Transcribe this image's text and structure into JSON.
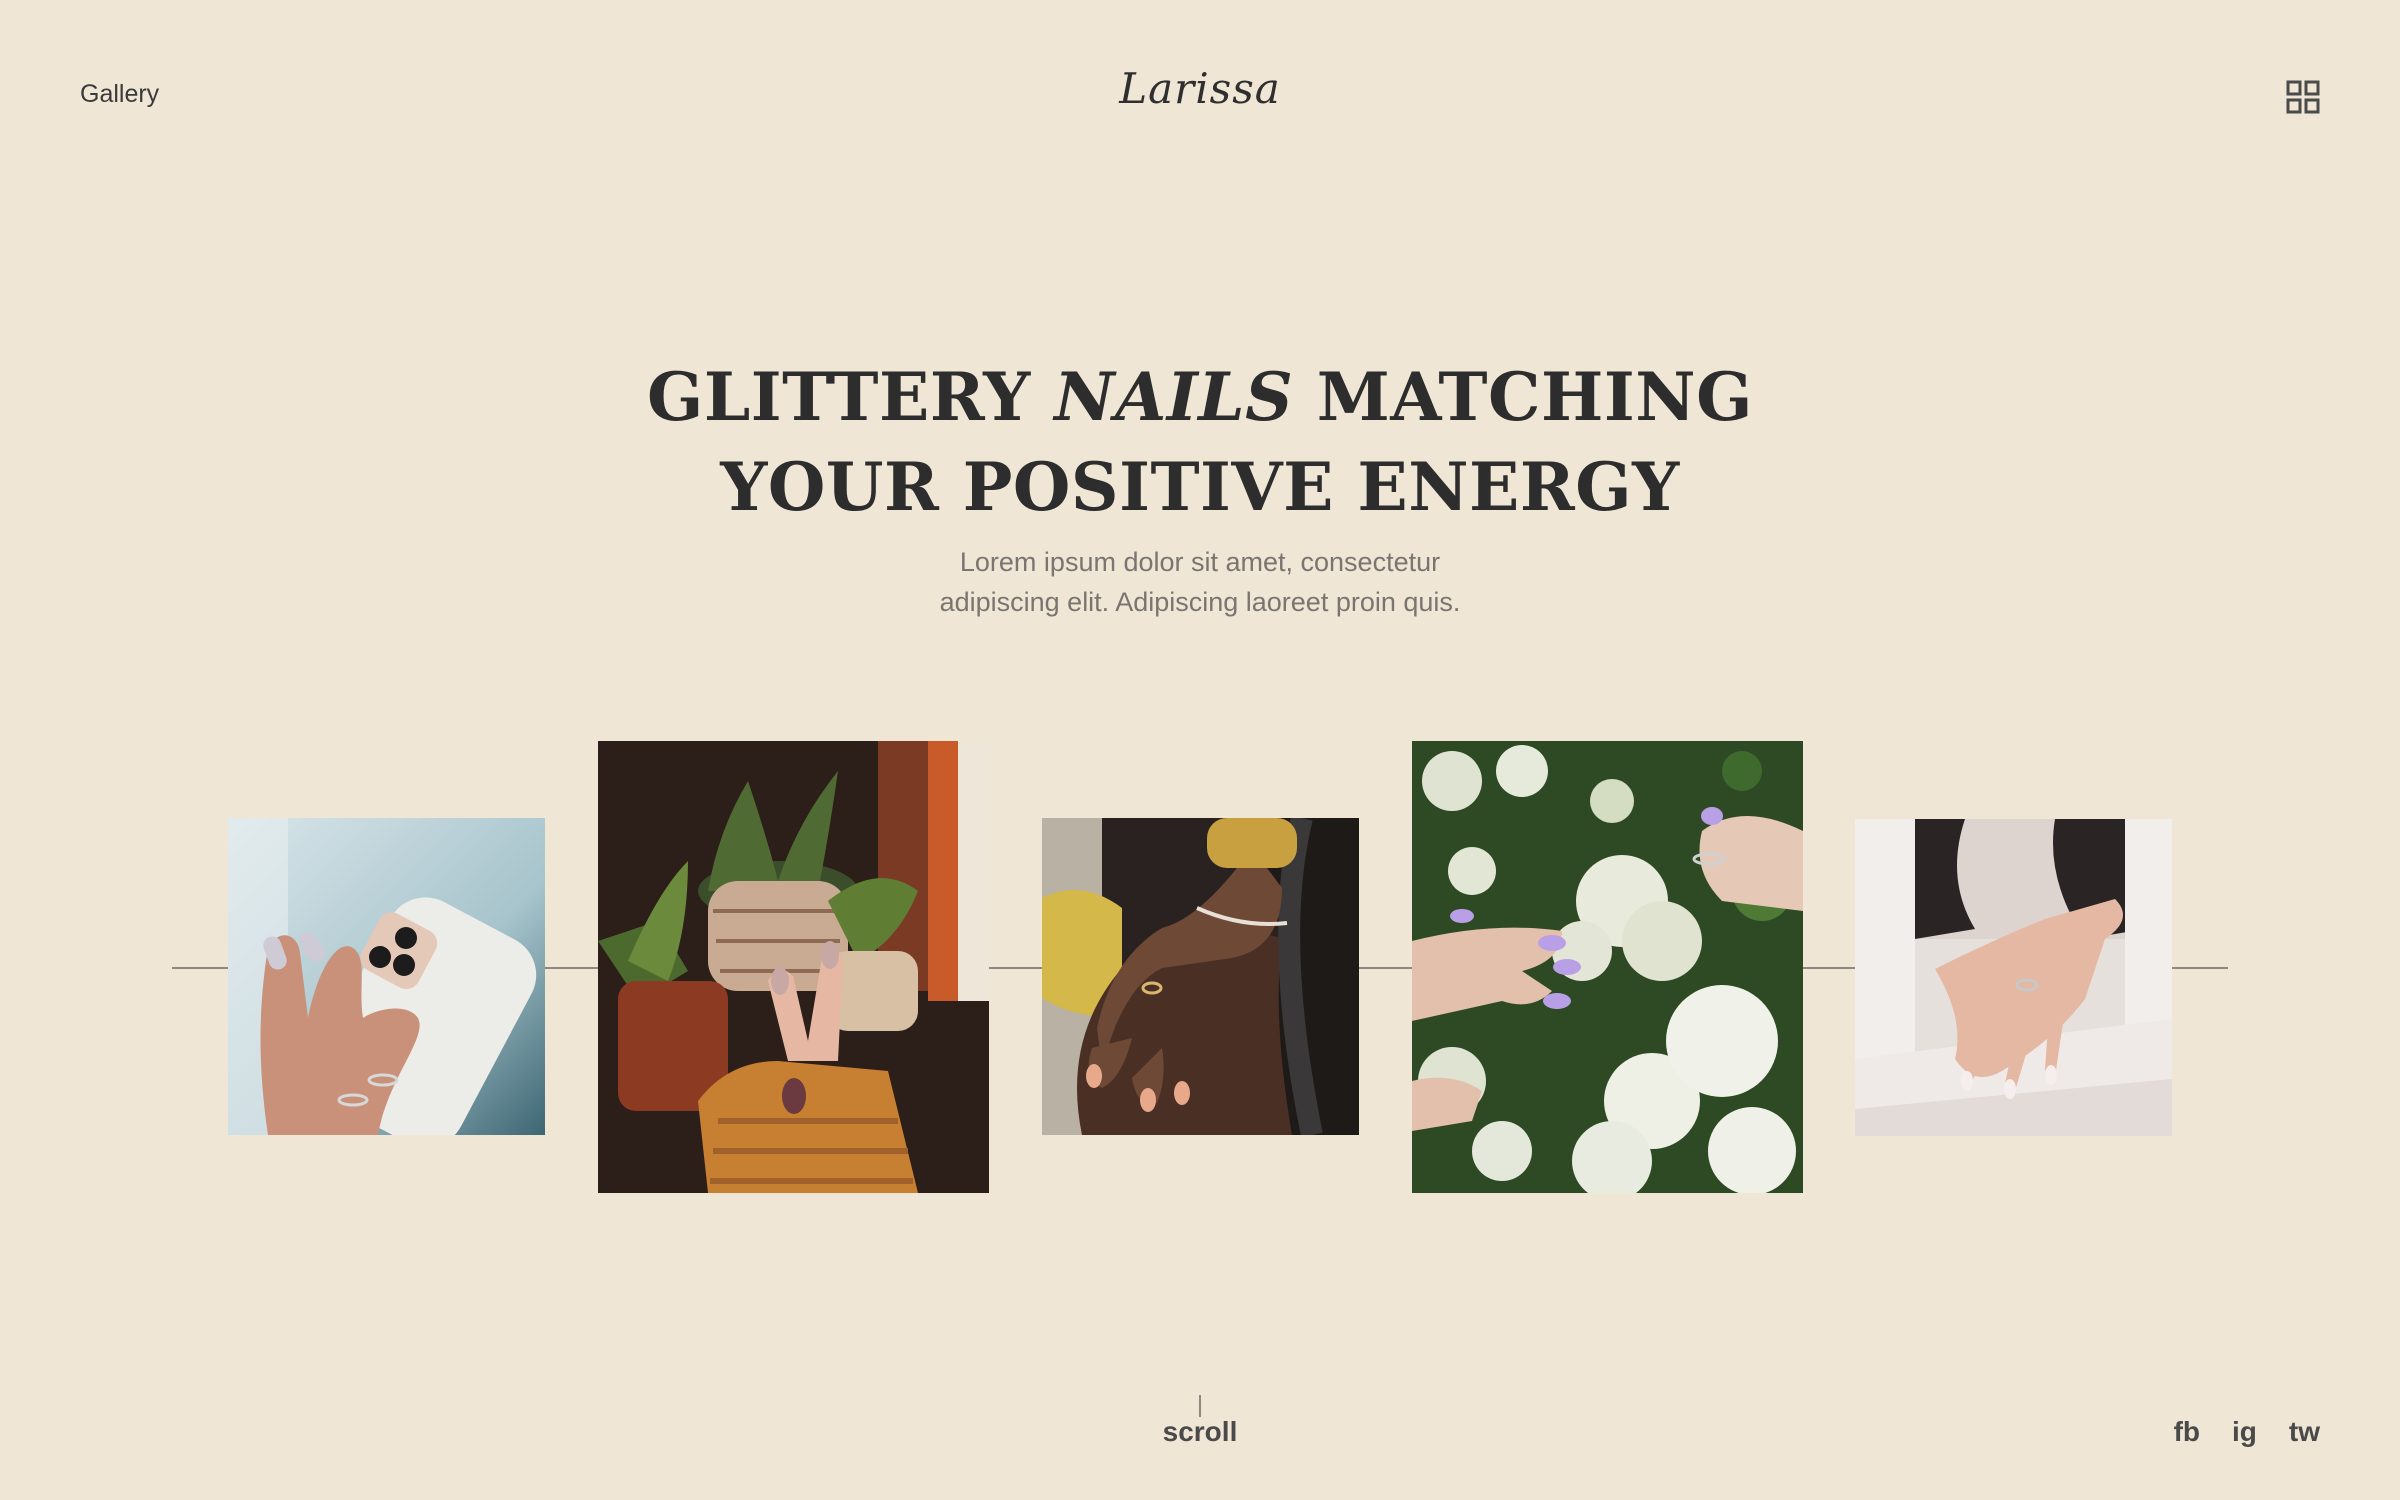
{
  "header": {
    "nav_label": "Gallery",
    "logo_text": "Larissa",
    "menu_icon": "grid-icon"
  },
  "hero": {
    "headline_part1": "GLITTERY ",
    "headline_em": "NAILS",
    "headline_part2": " MATCHING",
    "headline_line2": "YOUR POSITIVE ENERGY",
    "subtext_line1": "Lorem ipsum dolor sit amet, consectetur",
    "subtext_line2": "adipiscing elit. Adipiscing laoreet proin quis."
  },
  "gallery": {
    "photos": [
      {
        "subject": "hand-holding-phone"
      },
      {
        "subject": "hand-with-succulents"
      },
      {
        "subject": "hand-on-shoulder"
      },
      {
        "subject": "hands-with-flowers"
      },
      {
        "subject": "hand-with-ring"
      }
    ]
  },
  "footer": {
    "scroll_label": "scroll",
    "social": {
      "facebook": "fb",
      "instagram": "ig",
      "twitter": "tw"
    }
  },
  "colors": {
    "background": "#f0e6d6",
    "text_dark": "#2d2d2d",
    "text_muted": "#7a7570",
    "rail": "#8e8880"
  }
}
